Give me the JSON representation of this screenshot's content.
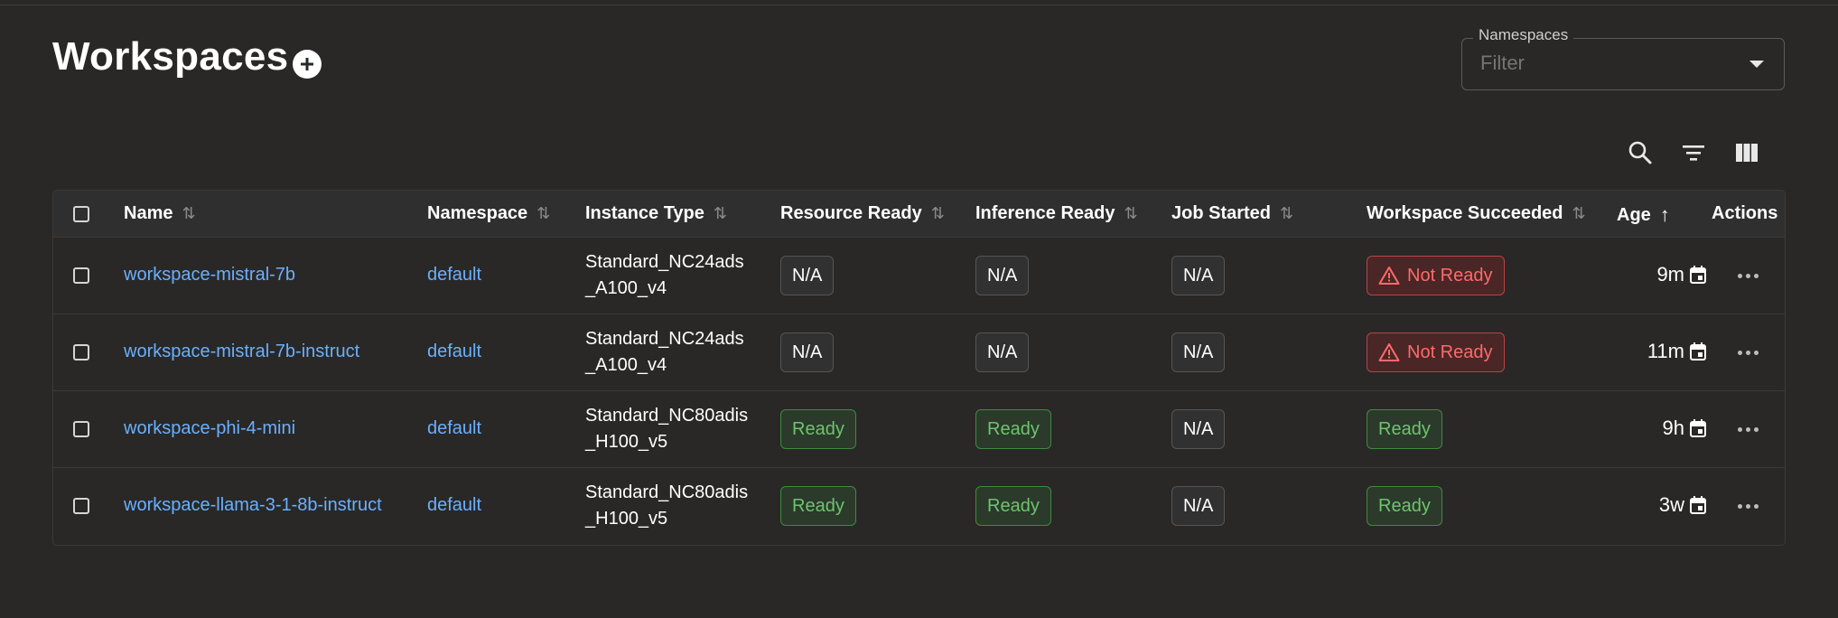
{
  "page": {
    "title": "Workspaces"
  },
  "namespace_filter": {
    "label": "Namespaces",
    "placeholder": "Filter"
  },
  "toolbar": {
    "icons": [
      "search-icon",
      "filter-icon",
      "columns-icon"
    ]
  },
  "table": {
    "columns": [
      "Name",
      "Namespace",
      "Instance Type",
      "Resource Ready",
      "Inference Ready",
      "Job Started",
      "Workspace Succeeded",
      "Age",
      "Actions"
    ],
    "rows": [
      {
        "name": "workspace-mistral-7b",
        "namespace": "default",
        "instance_type_line1": "Standard_NC24ads",
        "instance_type_line2": "_A100_v4",
        "resource_ready": "N/A",
        "inference_ready": "N/A",
        "job_started": "N/A",
        "workspace_succeeded": "Not Ready",
        "age": "9m"
      },
      {
        "name": "workspace-mistral-7b-instruct",
        "namespace": "default",
        "instance_type_line1": "Standard_NC24ads",
        "instance_type_line2": "_A100_v4",
        "resource_ready": "N/A",
        "inference_ready": "N/A",
        "job_started": "N/A",
        "workspace_succeeded": "Not Ready",
        "age": "11m"
      },
      {
        "name": "workspace-phi-4-mini",
        "namespace": "default",
        "instance_type_line1": "Standard_NC80adis",
        "instance_type_line2": "_H100_v5",
        "resource_ready": "Ready",
        "inference_ready": "Ready",
        "job_started": "N/A",
        "workspace_succeeded": "Ready",
        "age": "9h"
      },
      {
        "name": "workspace-llama-3-1-8b-instruct",
        "namespace": "default",
        "instance_type_line1": "Standard_NC80adis",
        "instance_type_line2": "_H100_v5",
        "resource_ready": "Ready",
        "inference_ready": "Ready",
        "job_started": "N/A",
        "workspace_succeeded": "Ready",
        "age": "3w"
      }
    ]
  },
  "colors": {
    "background": "#292827",
    "link": "#6ab0ff",
    "ready": "#6ec46e",
    "not_ready": "#ff6a6a"
  }
}
